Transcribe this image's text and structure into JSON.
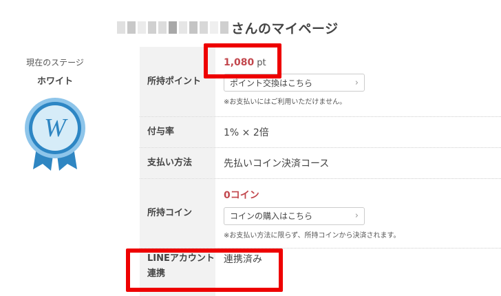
{
  "header": {
    "title_suffix": "さんのマイページ",
    "masked_name_colors": [
      "#e0e0e0",
      "#c8c8c8",
      "#ebebeb",
      "#d0d0d0",
      "#dcdcdc",
      "#a8a8a8",
      "#e6e6e6",
      "#c4c4c4",
      "#d8d8d8",
      "#efefef",
      "#cfcfcf"
    ]
  },
  "stage": {
    "label": "現在のステージ",
    "name": "ホワイト",
    "badge_letter": "W",
    "colors": {
      "ring": "#2d86c4",
      "face": "#d6ecf8",
      "ribbon": "#2f86c2"
    }
  },
  "account": {
    "points": {
      "label": "所持ポイント",
      "value": "1,080",
      "unit": "pt",
      "button": "ポイント交換はこちら",
      "note": "※お支払いにはご利用いただけません。"
    },
    "rate": {
      "label": "付与率",
      "value": "1% × 2倍"
    },
    "payment": {
      "label": "支払い方法",
      "value": "先払いコイン決済コース"
    },
    "coins": {
      "label": "所持コイン",
      "value": "0コイン",
      "button": "コインの購入はこちら",
      "note": "※お支払い方法に限らず、所持コインから決済されます。"
    },
    "line": {
      "label": "LINEアカウント連携",
      "value": "連携済み"
    }
  },
  "colors": {
    "accent_red": "#c2474d",
    "highlight": "#ee0000",
    "label_bg": "#f2f2f2"
  },
  "icons": {
    "chevron": "chevron-right-icon",
    "badge": "stage-badge-icon"
  }
}
